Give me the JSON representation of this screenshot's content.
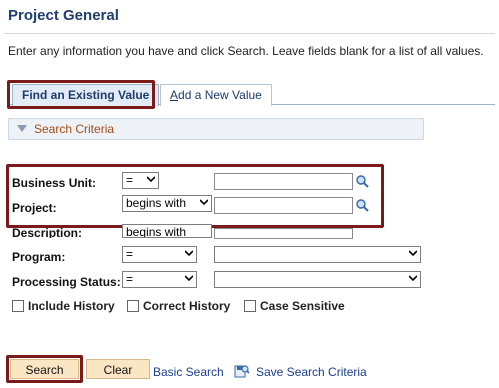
{
  "page": {
    "title": "Project General",
    "instructions": "Enter any information you have and click Search. Leave fields blank for a list of all values."
  },
  "tabs": [
    {
      "label": "Find an Existing Value"
    },
    {
      "label_first": "A",
      "label_rest": "dd a New Value"
    }
  ],
  "criteria": {
    "label": "Search Criteria"
  },
  "fields": {
    "business_unit": {
      "label": "Business Unit:",
      "operator": "="
    },
    "project": {
      "label": "Project:",
      "operator": "begins with"
    },
    "description": {
      "label": "Description:",
      "operator": "begins with"
    },
    "program": {
      "label": "Program:",
      "operator": "="
    },
    "processing_status": {
      "label": "Processing Status:",
      "operator": "="
    }
  },
  "checkboxes": {
    "include_history": "Include History",
    "correct_history": "Correct History",
    "case_sensitive": "Case Sensitive"
  },
  "buttons": {
    "search": "Search",
    "clear": "Clear",
    "basic_search": "Basic Search",
    "save_search_criteria": "Save Search Criteria"
  },
  "colors": {
    "highlight": "#7a1a1a",
    "button_bg": "#fbe6c4",
    "title": "#1f3f6f",
    "criteria_label": "#a14d16"
  }
}
